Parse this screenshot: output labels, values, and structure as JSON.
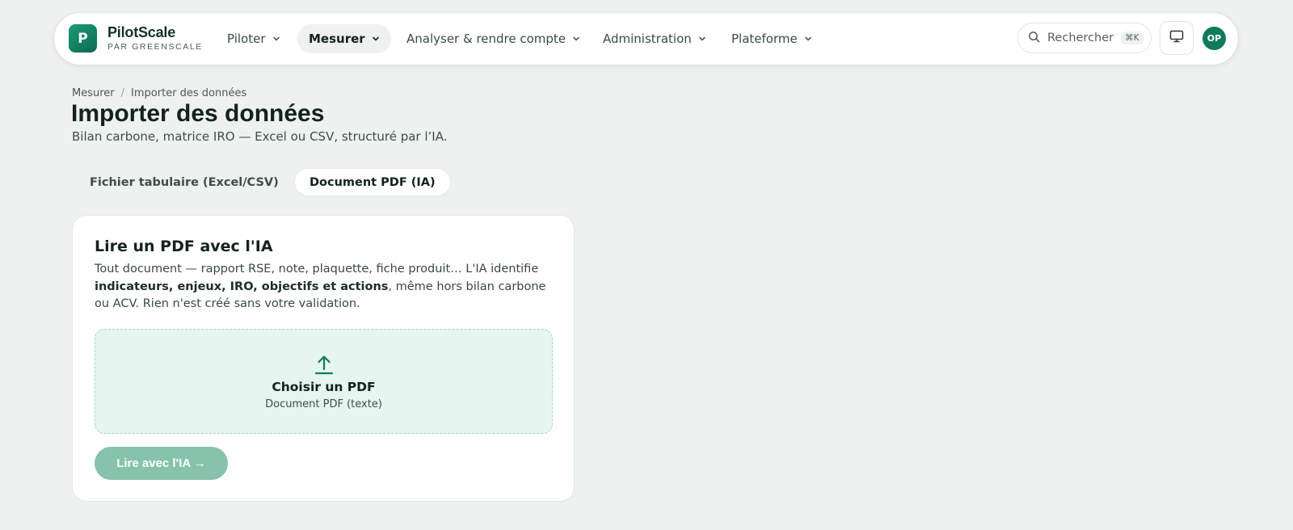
{
  "brand": {
    "logo_letter": "P",
    "name": "PilotScale",
    "subtitle": "PAR GREENSCALE"
  },
  "nav": [
    {
      "label": "Piloter",
      "active": false
    },
    {
      "label": "Mesurer",
      "active": true
    },
    {
      "label": "Analyser & rendre compte",
      "active": false
    },
    {
      "label": "Administration",
      "active": false
    },
    {
      "label": "Plateforme",
      "active": false
    }
  ],
  "search": {
    "placeholder": "Rechercher",
    "shortcut": "⌘K"
  },
  "user": {
    "initials": "OP"
  },
  "breadcrumb": {
    "parent": "Mesurer",
    "separator": "/",
    "current": "Importer des données"
  },
  "page": {
    "title": "Importer des données",
    "subtitle": "Bilan carbone, matrice IRO — Excel ou CSV, structuré par l’IA."
  },
  "tabs": [
    {
      "label": "Fichier tabulaire (Excel/CSV)",
      "active": false
    },
    {
      "label": "Document PDF (IA)",
      "active": true
    }
  ],
  "card": {
    "title": "Lire un PDF avec l'IA",
    "desc_before": "Tout document — rapport RSE, note, plaquette, fiche produit… L'IA identifie ",
    "desc_bold": "indicateurs, enjeux, IRO, objectifs et actions",
    "desc_after": ", même hors bilan carbone ou ACV. Rien n'est créé sans votre validation.",
    "dropzone_title": "Choisir un PDF",
    "dropzone_subtitle": "Document PDF (texte)",
    "submit_label": "Lire avec l'IA →"
  },
  "colors": {
    "accent": "#0f7a5c",
    "page_bg": "#edf1ef",
    "dropzone_bg": "#e6f5ef",
    "button_disabled": "#86c2ac"
  }
}
